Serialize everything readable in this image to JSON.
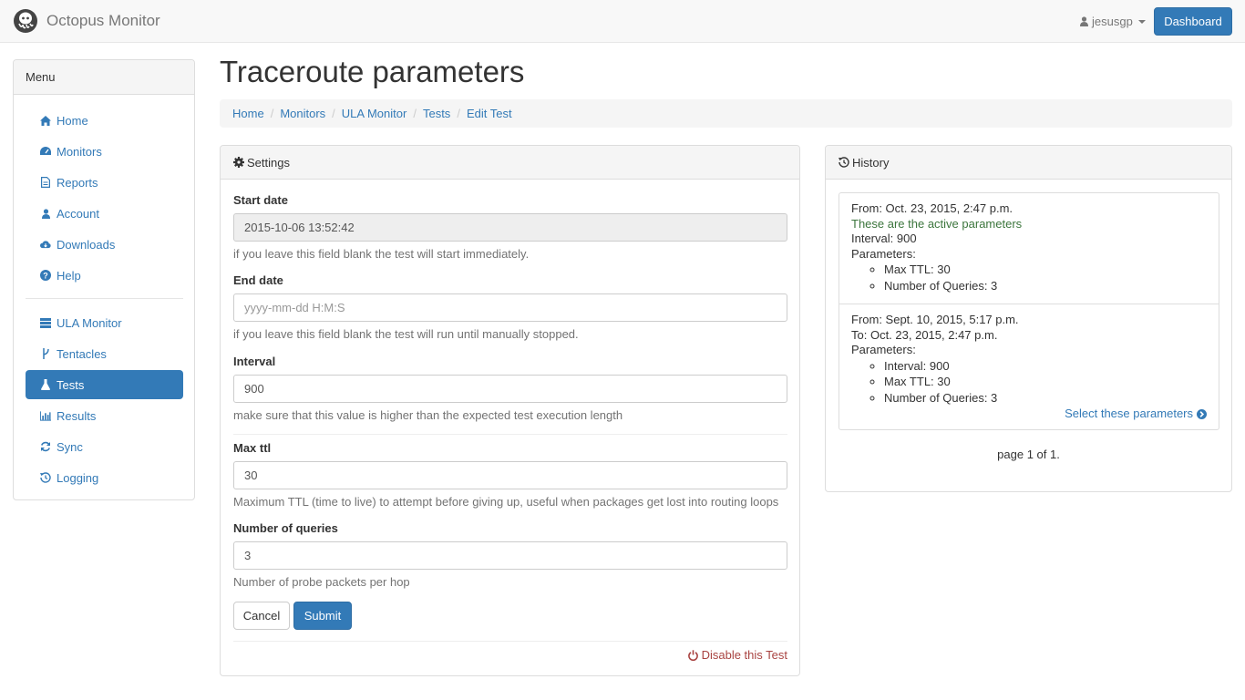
{
  "navbar": {
    "brand": "Octopus Monitor",
    "user": "jesusgp",
    "dashboard_label": "Dashboard"
  },
  "sidebar": {
    "title": "Menu",
    "items": [
      {
        "label": "Home",
        "icon": "home-icon"
      },
      {
        "label": "Monitors",
        "icon": "dashboard-icon"
      },
      {
        "label": "Reports",
        "icon": "file-icon"
      },
      {
        "label": "Account",
        "icon": "user-icon"
      },
      {
        "label": "Downloads",
        "icon": "cloud-download-icon"
      },
      {
        "label": "Help",
        "icon": "question-icon"
      }
    ],
    "items2": [
      {
        "label": "ULA Monitor",
        "icon": "server-icon"
      },
      {
        "label": "Tentacles",
        "icon": "branch-icon"
      },
      {
        "label": "Tests",
        "icon": "flask-icon",
        "active": true
      },
      {
        "label": "Results",
        "icon": "bar-chart-icon"
      },
      {
        "label": "Sync",
        "icon": "refresh-icon"
      },
      {
        "label": "Logging",
        "icon": "history-icon"
      }
    ]
  },
  "page": {
    "title": "Traceroute parameters",
    "breadcrumb": [
      "Home",
      "Monitors",
      "ULA Monitor",
      "Tests",
      "Edit Test"
    ]
  },
  "settings": {
    "title": "Settings",
    "start_date": {
      "label": "Start date",
      "value": "2015-10-06 13:52:42",
      "help": "if you leave this field blank the test will start immediately."
    },
    "end_date": {
      "label": "End date",
      "value": "",
      "placeholder": "yyyy-mm-dd H:M:S",
      "help": "if you leave this field blank the test will run until manually stopped."
    },
    "interval": {
      "label": "Interval",
      "value": "900",
      "help": "make sure that this value is higher than the expected test execution length"
    },
    "max_ttl": {
      "label": "Max ttl",
      "value": "30",
      "help": "Maximum TTL (time to live) to attempt before giving up, useful when packages get lost into routing loops"
    },
    "queries": {
      "label": "Number of queries",
      "value": "3",
      "help": "Number of probe packets per hop"
    },
    "cancel_label": "Cancel",
    "submit_label": "Submit",
    "disable_label": "Disable this Test"
  },
  "history": {
    "title": "History",
    "entries": [
      {
        "from": "From: Oct. 23, 2015, 2:47 p.m.",
        "active_note": "These are the active parameters",
        "interval": "Interval: 900",
        "params_label": "Parameters:",
        "params": [
          "Max TTL: 30",
          "Number of Queries: 3"
        ]
      },
      {
        "from": "From: Sept. 10, 2015, 5:17 p.m.",
        "to": "To: Oct. 23, 2015, 2:47 p.m.",
        "params_label": "Parameters:",
        "params": [
          "Interval: 900",
          "Max TTL: 30",
          "Number of Queries: 3"
        ],
        "select_label": "Select these parameters"
      }
    ],
    "pager": "page 1 of 1."
  }
}
